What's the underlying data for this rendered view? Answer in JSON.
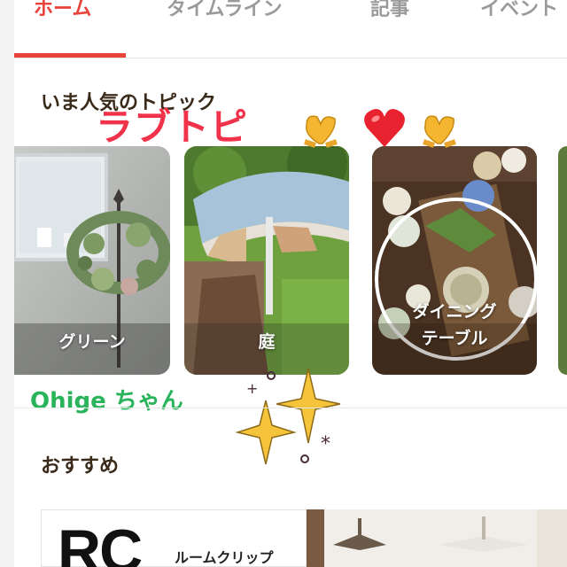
{
  "tabs": [
    {
      "label": "ホーム",
      "active": true
    },
    {
      "label": "タイムライン",
      "active": false
    },
    {
      "label": "記事",
      "active": false
    },
    {
      "label": "イベント",
      "active": false
    }
  ],
  "popular": {
    "title": "いま人気のトピック",
    "cards": [
      {
        "label": "グリーン"
      },
      {
        "label": "庭"
      },
      {
        "label": "ダイニング\nテーブル"
      }
    ]
  },
  "overlay": {
    "sticker_title": "ラブトピ",
    "handle": "Ohige ちゃん",
    "icons": [
      "heart-hands-emoji",
      "red-heart-emoji",
      "heart-hands-emoji",
      "sparkles-emoji"
    ]
  },
  "recommend": {
    "title": "おすすめ",
    "logo": "RC",
    "brand": "ルームクリップ"
  },
  "colors": {
    "accent": "#e8433a",
    "sticker_red": "#f0324b",
    "handle_green": "#29b35a",
    "heading": "#3a2a1a"
  }
}
